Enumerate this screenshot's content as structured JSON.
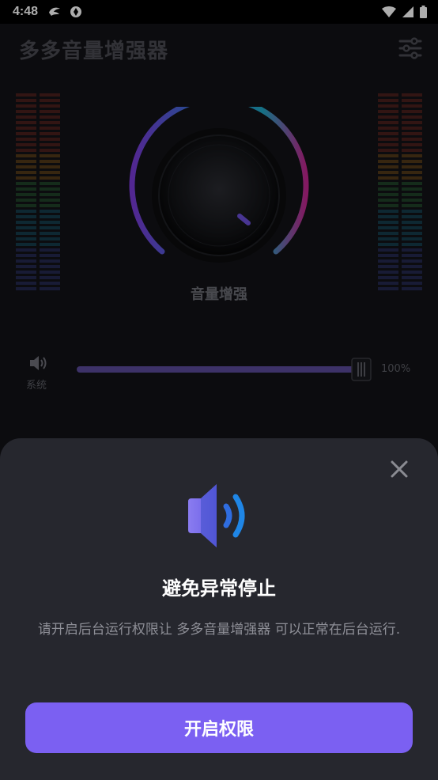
{
  "status_bar": {
    "time": "4:48",
    "left_icons": [
      "hummingbird-icon",
      "ring-icon"
    ],
    "right_icons": [
      "wifi-icon",
      "signal-icon",
      "battery-icon"
    ]
  },
  "app": {
    "title": "多多音量增强器",
    "menu_icon": "sliders-icon",
    "knob": {
      "label": "音量增强"
    },
    "volume": {
      "label": "系统",
      "value_text": "100%",
      "level": 1.0
    }
  },
  "dialog": {
    "title": "避免异常停止",
    "description": "请开启后台运行权限让 多多音量增强器 可以正常在后台运行.",
    "button_label": "开启权限",
    "icon": "speaker-icon",
    "close_icon": "close-icon"
  },
  "colors": {
    "accent": "#7b60f2",
    "sheet_bg": "#26272e",
    "background": "#121317",
    "speaker_light": "#7b6cf0",
    "speaker_dark": "#1f6fe0"
  }
}
